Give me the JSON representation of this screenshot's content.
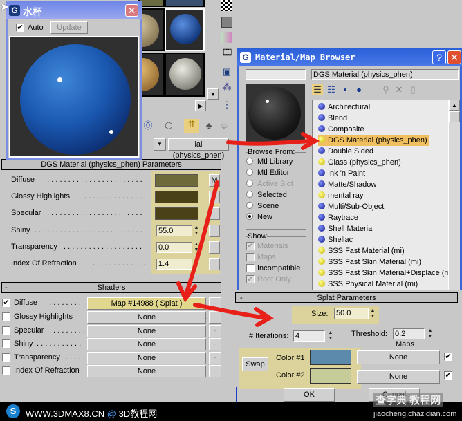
{
  "preview_window": {
    "title": "水杯",
    "auto_label": "Auto",
    "auto_checked": true,
    "update_label": "Update"
  },
  "material_name_field": "ial (physics_phen)",
  "dgs_rollout": {
    "title": "DGS Material (physics_phen) Parameters",
    "rows": [
      {
        "label": "Diffuse",
        "color": "#6e6a3a",
        "map_button": "M"
      },
      {
        "label": "Glossy Highlights",
        "color": "#4a4216"
      },
      {
        "label": "Specular",
        "color": "#4a4216"
      },
      {
        "label": "Shiny",
        "value": "55.0"
      },
      {
        "label": "Transparency",
        "value": "0.0"
      },
      {
        "label": "Index Of Refraction",
        "value": "1.4"
      }
    ]
  },
  "shaders_rollout": {
    "title": "Shaders",
    "rows": [
      {
        "label": "Diffuse",
        "checked": true,
        "map": "Map #14988  ( Splat )"
      },
      {
        "label": "Glossy Highlights",
        "checked": false,
        "map": "None"
      },
      {
        "label": "Specular",
        "checked": false,
        "map": "None"
      },
      {
        "label": "Shiny",
        "checked": false,
        "map": "None"
      },
      {
        "label": "Transparency",
        "checked": false,
        "map": "None"
      },
      {
        "label": "Index Of Refraction",
        "checked": false,
        "map": "None"
      }
    ]
  },
  "browser": {
    "title": "Material/Map Browser",
    "name_field": "",
    "selected_name": "DGS Material (physics_phen)",
    "browse_from": {
      "label": "Browse From:",
      "options": [
        "Mtl Library",
        "Mtl Editor",
        "Active Slot",
        "Selected",
        "Scene",
        "New"
      ],
      "selected": "New",
      "disabled": [
        "Active Slot"
      ]
    },
    "show": {
      "label": "Show",
      "options": [
        {
          "label": "Materials",
          "checked": true,
          "disabled": true
        },
        {
          "label": "Maps",
          "checked": false,
          "disabled": true
        },
        {
          "label": "Incompatible",
          "checked": false,
          "disabled": false
        },
        {
          "label": "Root Only",
          "checked": true,
          "disabled": true
        }
      ]
    },
    "items": [
      {
        "label": "Architectural",
        "type": "blue"
      },
      {
        "label": "Blend",
        "type": "blue"
      },
      {
        "label": "Composite",
        "type": "blue"
      },
      {
        "label": "DGS Material (physics_phen)",
        "type": "yellow",
        "selected": true
      },
      {
        "label": "Double Sided",
        "type": "blue"
      },
      {
        "label": "Glass (physics_phen)",
        "type": "yellow"
      },
      {
        "label": "Ink 'n Paint",
        "type": "blue"
      },
      {
        "label": "Matte/Shadow",
        "type": "blue"
      },
      {
        "label": "mental ray",
        "type": "yellow"
      },
      {
        "label": "Multi/Sub-Object",
        "type": "blue"
      },
      {
        "label": "Raytrace",
        "type": "blue"
      },
      {
        "label": "Shell Material",
        "type": "blue"
      },
      {
        "label": "Shellac",
        "type": "blue"
      },
      {
        "label": "SSS Fast Material (mi)",
        "type": "yellow"
      },
      {
        "label": "SSS Fast Skin Material (mi)",
        "type": "yellow"
      },
      {
        "label": "SSS Fast Skin Material+Displace (mi)",
        "type": "yellow"
      },
      {
        "label": "SSS Physical Material (mi)",
        "type": "yellow"
      }
    ],
    "ok_label": "OK",
    "cancel_label": "Cancel"
  },
  "splat": {
    "title": "Splat Parameters",
    "size_label": "Size:",
    "size": "50.0",
    "iterations_label": "# Iterations:",
    "iterations": "4",
    "threshold_label": "Threshold:",
    "threshold": "0.2",
    "maps_label": "Maps",
    "swap_label": "Swap",
    "color1_label": "Color #1",
    "color1": "#5b8aad",
    "color2_label": "Color #2",
    "color2": "#c6cc98",
    "map1": "None",
    "map2": "None",
    "map1_enabled": true,
    "map2_enabled": true
  },
  "footer": {
    "site": "WWW.3DMAX8.CN",
    "at": "@",
    "site_cn": "3D教程网",
    "watermark": "查字典 教程网",
    "watermark_url": "jiaocheng.chazidian.com"
  },
  "colors": {
    "highlight": "#e1d78c",
    "arrow": "#e8201a",
    "titlebar": "#2a5fd8"
  }
}
